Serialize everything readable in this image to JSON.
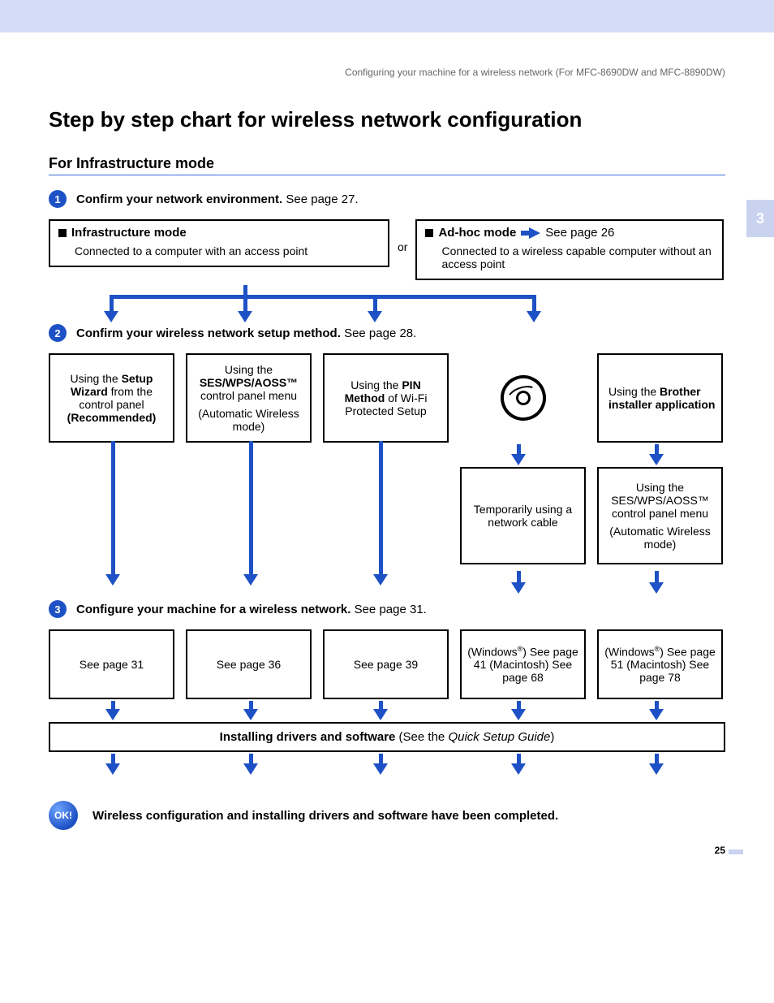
{
  "header_note": "Configuring your machine for a wireless network (For MFC-8690DW and MFC-8890DW)",
  "title": "Step by step chart for wireless network configuration",
  "subtitle": "For Infrastructure mode",
  "chapter_tab": "3",
  "page_number": "25",
  "step1": {
    "bold": "Confirm your network environment.",
    "rest": " See page 27."
  },
  "mode_left": {
    "title": "Infrastructure mode",
    "desc": "Connected to a computer with an access point"
  },
  "or": "or",
  "mode_right": {
    "title": "Ad-hoc mode",
    "see": "See page 26",
    "desc": "Connected to a wireless capable computer without an access point"
  },
  "step2": {
    "bold": "Confirm your wireless network setup method.",
    "rest": " See page 28."
  },
  "methods": {
    "m1": {
      "pre": "Using the ",
      "b": "Setup Wizard",
      "post": " from the control panel ",
      "rec": "(Recommended)"
    },
    "m2": {
      "pre": "Using the ",
      "b": "SES/WPS/AOSS™",
      "post": " control panel menu",
      "auto": "(Automatic Wireless mode)"
    },
    "m3": {
      "pre": "Using the ",
      "b": "PIN Method",
      "post": " of Wi-Fi Protected Setup"
    },
    "m5": {
      "pre": "Using the ",
      "b": "Brother installer application"
    }
  },
  "sub4": "Temporarily using a network cable",
  "sub5": {
    "pre": "Using the ",
    "b": "SES/WPS/AOSS™",
    "post": " control panel menu",
    "auto": "(Automatic Wireless mode)"
  },
  "step3": {
    "bold": "Configure your machine for a wireless network.",
    "rest": " See page 31."
  },
  "pages": {
    "p1": "See page 31",
    "p2": "See page 36",
    "p3": "See page 39",
    "p4a": "(Windows",
    "p4b": ") See page 41 (Macintosh) See page 68",
    "p5a": "(Windows",
    "p5b": ") See page 51 (Macintosh) See page 78"
  },
  "install": {
    "b": "Installing drivers and software",
    "mid": " (See the ",
    "i": "Quick Setup Guide",
    "end": ")"
  },
  "ok_label": "OK!",
  "ok_text": "Wireless configuration and installing drivers and software have been completed."
}
